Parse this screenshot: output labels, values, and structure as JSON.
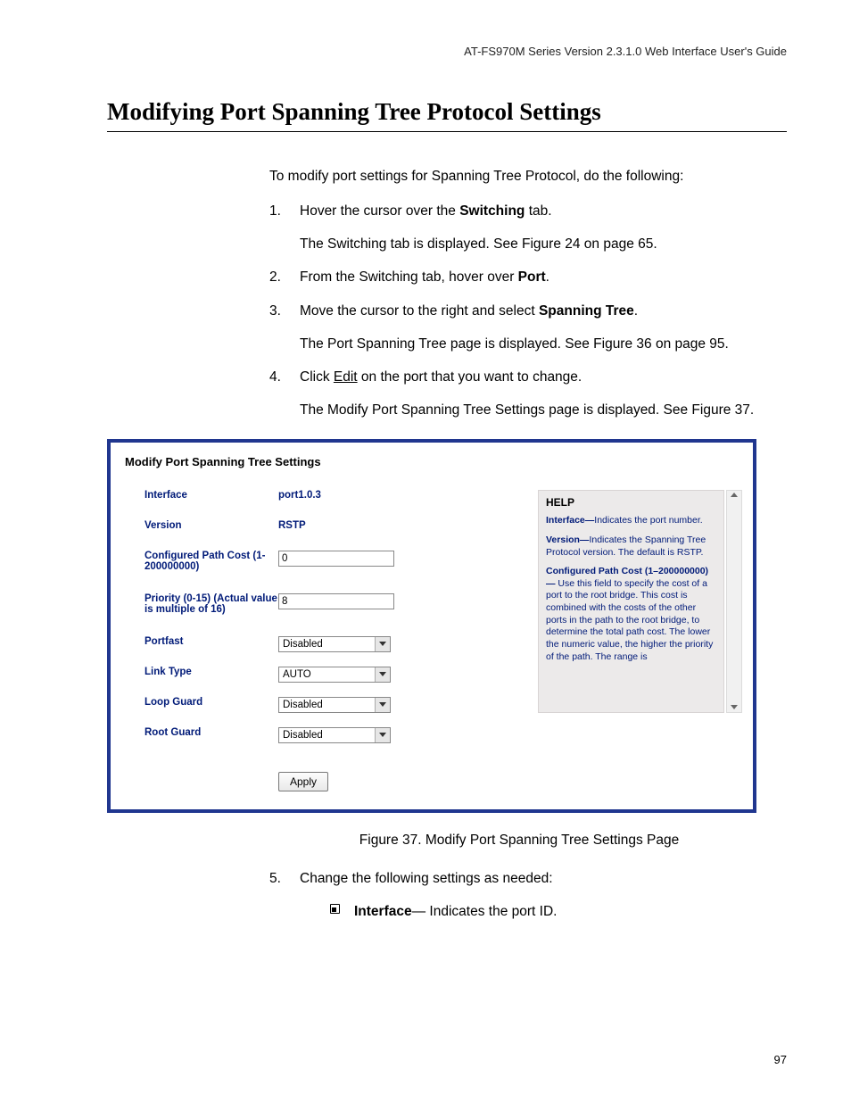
{
  "header": {
    "doc_title": "AT-FS970M Series Version 2.3.1.0 Web Interface User's Guide"
  },
  "title": "Modifying Port Spanning Tree Protocol Settings",
  "intro": "To modify port settings for Spanning Tree Protocol, do the following:",
  "steps": {
    "s1": {
      "num": "1.",
      "pre": "Hover the cursor over the ",
      "bold": "Switching",
      "post": " tab.",
      "sub": "The Switching tab is displayed. See Figure 24 on page 65."
    },
    "s2": {
      "num": "2.",
      "pre": "From the Switching tab, hover over ",
      "bold": "Port",
      "post": "."
    },
    "s3": {
      "num": "3.",
      "pre": "Move the cursor to the right and select ",
      "bold": "Spanning Tree",
      "post": ".",
      "sub": "The Port Spanning Tree page is displayed. See Figure 36 on page 95."
    },
    "s4": {
      "num": "4.",
      "pre": "Click ",
      "link": "Edit",
      "post": " on the port that you want to change.",
      "sub": "The Modify Port Spanning Tree Settings page is displayed. See Figure 37."
    },
    "s5": {
      "num": "5.",
      "text": "Change the following settings as needed:"
    }
  },
  "panel": {
    "title": "Modify Port Spanning Tree Settings",
    "labels": {
      "interface": "Interface",
      "version": "Version",
      "cpc": "Configured Path Cost (1-200000000)",
      "priority": "Priority (0-15) (Actual value is multiple of 16)",
      "portfast": "Portfast",
      "linktype": "Link Type",
      "loopguard": "Loop Guard",
      "rootguard": "Root Guard"
    },
    "values": {
      "interface": "port1.0.3",
      "version": "RSTP",
      "cpc": "0",
      "priority": "8",
      "portfast": "Disabled",
      "linktype": "AUTO",
      "loopguard": "Disabled",
      "rootguard": "Disabled"
    },
    "apply": "Apply",
    "help": {
      "heading": "HELP",
      "p1a": "Interface—",
      "p1b": "Indicates the port number.",
      "p2a": "Version—",
      "p2b": "Indicates the Spanning Tree Protocol version. The default is RSTP.",
      "p3a": "Configured Path Cost (1–200000000)—",
      "p3b": " Use this field to specify the cost of a port to the root bridge. This cost is combined with the costs of the other ports in the path to the root bridge, to determine the total path cost. The lower the numeric value, the higher the priority of the path. The range is"
    }
  },
  "figure_caption": "Figure 37. Modify Port Spanning Tree Settings Page",
  "bullet": {
    "bold": "Interface",
    "rest": "— Indicates the port ID."
  },
  "page_number": "97"
}
